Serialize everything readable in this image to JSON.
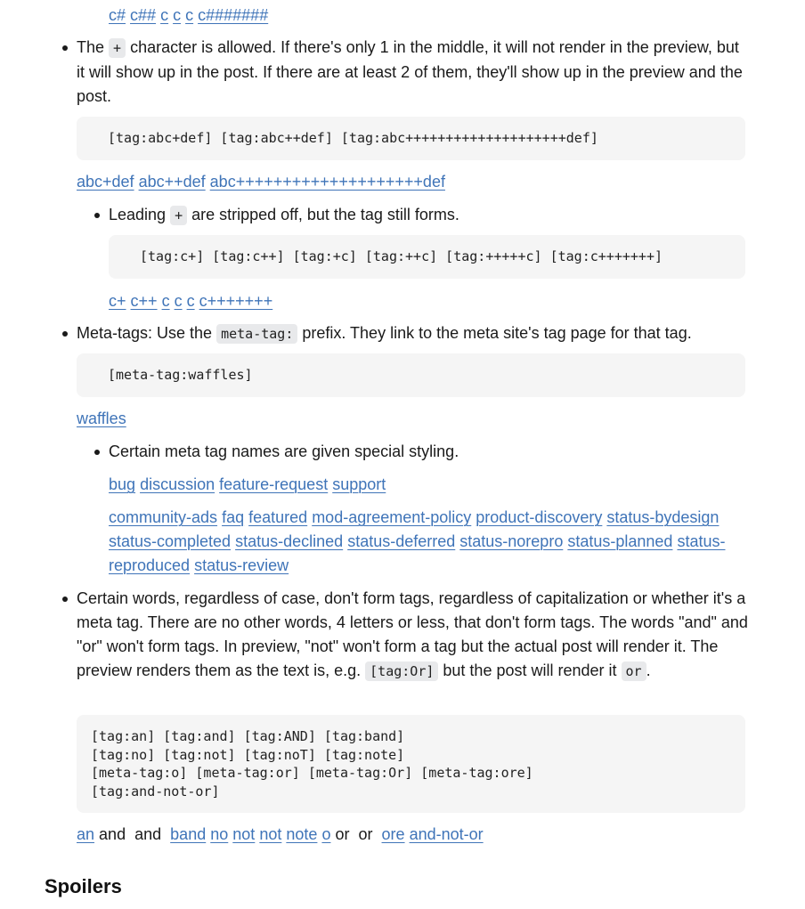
{
  "top_tags": [
    "c#",
    "c##",
    "c",
    "c",
    "c",
    "c#######"
  ],
  "plus_section": {
    "text_before": "The ",
    "code": "+",
    "text_after": " character is allowed. If there's only 1 in the middle, it will not render in the preview, but it will show up in the post. If there are at least 2 of them, they'll show up in the preview and the post.",
    "code_block": "[tag:abc+def] [tag:abc++def] [tag:abc++++++++++++++++++++def]",
    "tags": [
      "abc+def",
      "abc++def",
      "abc++++++++++++++++++++def"
    ],
    "sub": {
      "text_before": "Leading ",
      "code": "+",
      "text_after": " are stripped off, but the tag still forms.",
      "code_block": "[tag:c+] [tag:c++] [tag:+c] [tag:++c] [tag:+++++c] [tag:c+++++++]",
      "tags": [
        "c+",
        "c++",
        "c",
        "c",
        "c",
        "c+++++++"
      ]
    }
  },
  "meta_section": {
    "text_before": "Meta-tags: Use the ",
    "code": "meta-tag:",
    "text_after": " prefix. They link to the meta site's tag page for that tag.",
    "code_block": "[meta-tag:waffles]",
    "tags": [
      "waffles"
    ],
    "sub": {
      "text": "Certain meta tag names are given special styling.",
      "tags_row1": [
        "bug",
        "discussion",
        "feature-request",
        "support"
      ],
      "tags_row2": [
        "community-ads",
        "faq",
        "featured",
        "mod-agreement-policy",
        "product-discovery",
        "status-bydesign",
        "status-completed",
        "status-declined",
        "status-deferred",
        "status-norepro",
        "status-planned",
        "status-reproduced",
        "status-review"
      ]
    }
  },
  "words_section": {
    "text_before": "Certain words, regardless of case, don't form tags, regardless of capitalization or whether it's a meta tag. There are no other words, 4 letters or less, that don't form tags. The words \"and\" and \"or\" won't form tags. In preview, \"not\" won't form a tag but the actual post will render it. The preview renders them as the text is, e.g. ",
    "code1": "[tag:Or]",
    "text_middle": " but the post will render it ",
    "code2": "or",
    "text_after": ".",
    "code_block": "[tag:an] [tag:and] [tag:AND] [tag:band]\n[tag:no] [tag:not] [tag:noT] [tag:note]\n[meta-tag:o] [meta-tag:or] [meta-tag:Or] [meta-tag:ore]\n[tag:and-not-or]",
    "result": [
      {
        "text": "an",
        "link": true
      },
      {
        "text": "and",
        "link": false
      },
      {
        "text": "and",
        "link": false
      },
      {
        "text": "band",
        "link": true
      },
      {
        "text": "no",
        "link": true
      },
      {
        "text": "not",
        "link": true
      },
      {
        "text": "not",
        "link": true
      },
      {
        "text": "note",
        "link": true
      },
      {
        "text": "o",
        "link": true
      },
      {
        "text": "or",
        "link": false
      },
      {
        "text": "or",
        "link": false
      },
      {
        "text": "ore",
        "link": true
      },
      {
        "text": "and-not-or",
        "link": true
      }
    ]
  },
  "spoilers_heading": "Spoilers"
}
